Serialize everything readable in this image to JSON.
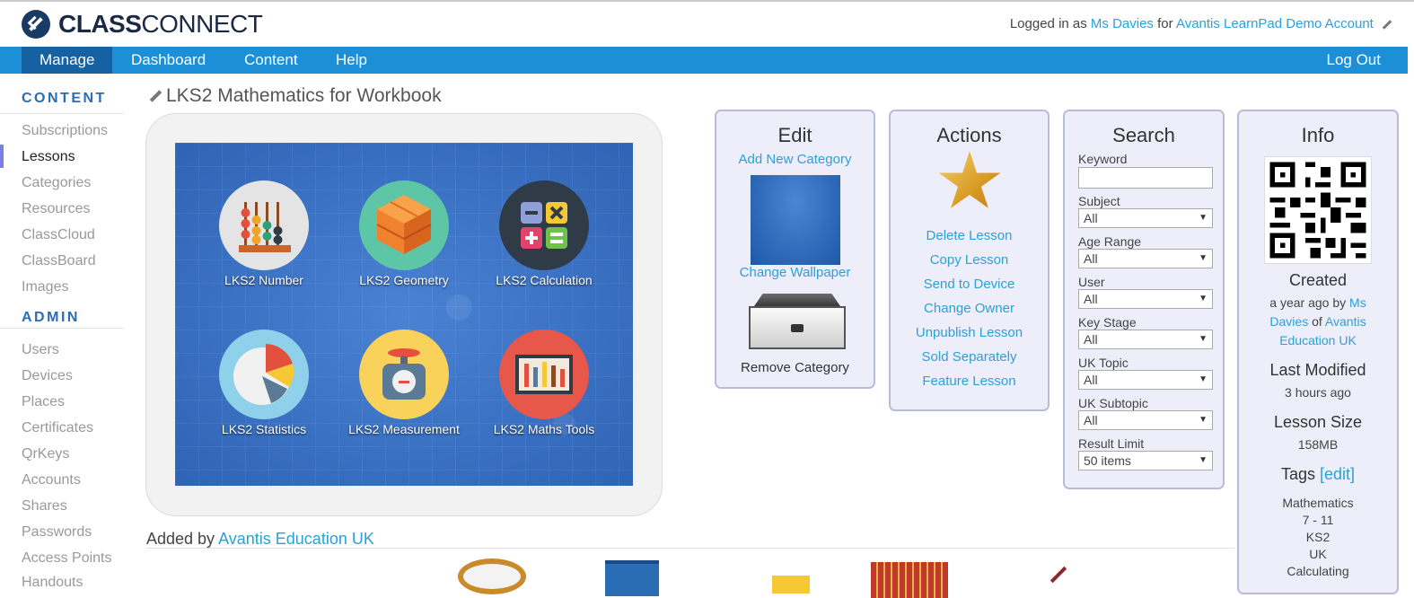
{
  "header": {
    "logo_bold": "CLASS",
    "logo_light": "CONNECT",
    "logged_in_prefix": "Logged in as",
    "user_name": "Ms Davies",
    "for_word": "for",
    "account_name": "Avantis LearnPad Demo Account"
  },
  "nav": {
    "manage": "Manage",
    "dashboard": "Dashboard",
    "content": "Content",
    "help": "Help",
    "logout": "Log Out"
  },
  "sidebar": {
    "content_heading": "CONTENT",
    "content_items": [
      "Subscriptions",
      "Lessons",
      "Categories",
      "Resources",
      "ClassCloud",
      "ClassBoard",
      "Images"
    ],
    "active_item": "Lessons",
    "admin_heading": "ADMIN",
    "admin_items": [
      "Users",
      "Devices",
      "Places",
      "Certificates",
      "QrKeys",
      "Accounts",
      "Shares",
      "Passwords",
      "Access Points",
      "Handouts"
    ]
  },
  "lesson": {
    "title": "LKS2 Mathematics for Workbook",
    "apps": [
      {
        "label": "LKS2 Number",
        "icon": "abacus-icon",
        "color": "#e4e4e4"
      },
      {
        "label": "LKS2 Geometry",
        "icon": "cubes-icon",
        "color": "#5cc6a6"
      },
      {
        "label": "LKS2 Calculation",
        "icon": "calculator-icon",
        "color": "#2f3b47"
      },
      {
        "label": "LKS2 Statistics",
        "icon": "pie-chart-icon",
        "color": "#8fd0ea"
      },
      {
        "label": "LKS2 Measurement",
        "icon": "scale-icon",
        "color": "#f8d25a"
      },
      {
        "label": "LKS2 Maths Tools",
        "icon": "tools-icon",
        "color": "#e7574a"
      }
    ]
  },
  "edit_panel": {
    "title": "Edit",
    "add_category": "Add New Category",
    "change_wallpaper": "Change Wallpaper",
    "remove_category": "Remove Category"
  },
  "actions_panel": {
    "title": "Actions",
    "links": [
      "Delete Lesson",
      "Copy Lesson",
      "Send to Device",
      "Change Owner",
      "Unpublish Lesson",
      "Sold Separately",
      "Feature Lesson"
    ]
  },
  "search_panel": {
    "title": "Search",
    "keyword_label": "Keyword",
    "keyword_value": "",
    "fields": [
      {
        "label": "Subject",
        "value": "All"
      },
      {
        "label": "Age Range",
        "value": "All"
      },
      {
        "label": "User",
        "value": "All"
      },
      {
        "label": "Key Stage",
        "value": "All"
      },
      {
        "label": "UK Topic",
        "value": "All"
      },
      {
        "label": "UK Subtopic",
        "value": "All"
      },
      {
        "label": "Result Limit",
        "value": "50 items"
      }
    ]
  },
  "info_panel": {
    "title": "Info",
    "created_heading": "Created",
    "created_when": "a year ago by",
    "created_user": "Ms Davies",
    "created_of": "of",
    "created_org": "Avantis Education UK",
    "modified_heading": "Last Modified",
    "modified_value": "3 hours ago",
    "size_heading": "Lesson Size",
    "size_value": "158MB",
    "tags_heading": "Tags",
    "tags_edit": "[edit]",
    "tags": [
      "Mathematics",
      "7 - 11",
      "KS2",
      "UK",
      "Calculating"
    ]
  },
  "footer": {
    "added_by_label": "Added by",
    "added_by_name": "Avantis Education UK"
  },
  "colors": {
    "nav_blue": "#1c8fd6",
    "nav_active": "#1661a2",
    "link": "#2aa0d8",
    "panel_bg": "#eeeefb",
    "panel_border": "#b9bcd6"
  }
}
